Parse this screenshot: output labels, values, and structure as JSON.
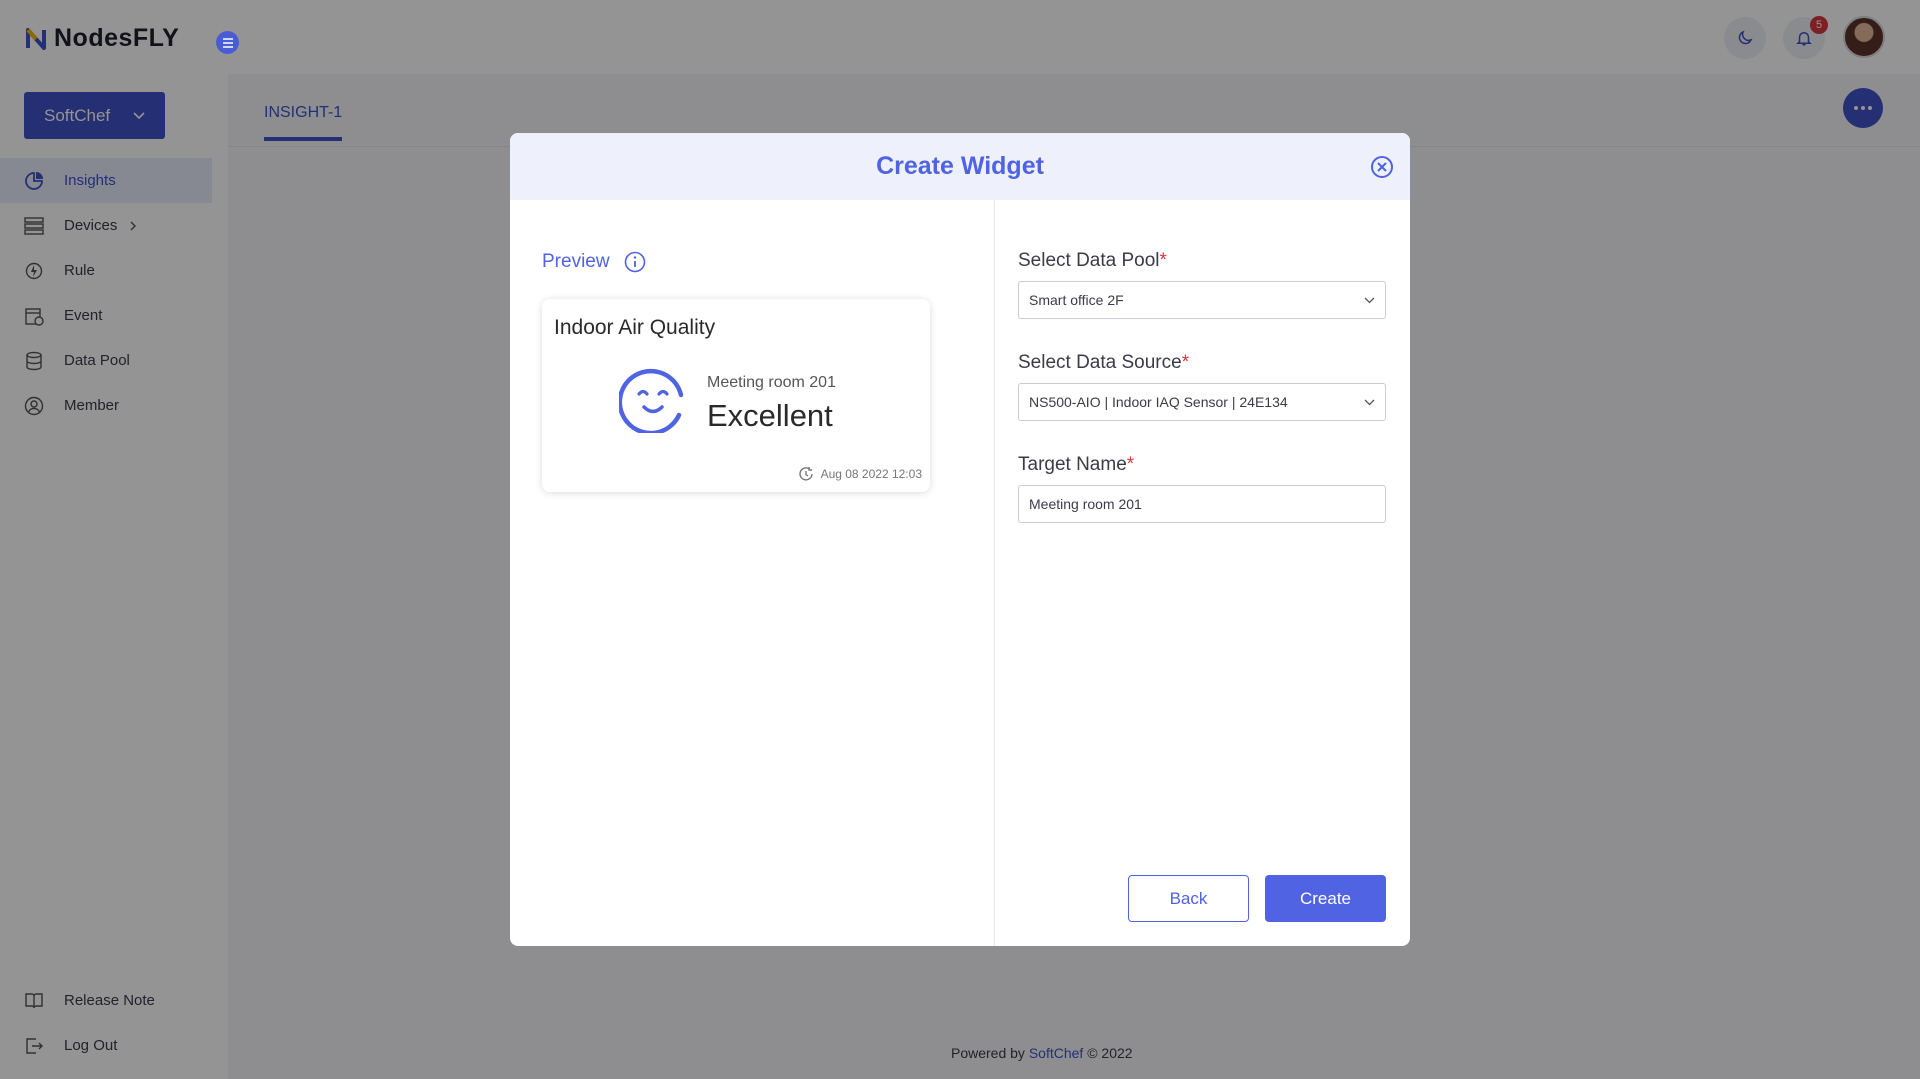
{
  "app": {
    "name": "NodesFLY"
  },
  "header": {
    "notification_count": "5"
  },
  "sidebar": {
    "org": "SoftChef",
    "items": [
      {
        "label": "Insights",
        "icon": "pie-chart-icon",
        "active": true
      },
      {
        "label": "Devices",
        "icon": "devices-grid-icon",
        "has_submenu": true
      },
      {
        "label": "Rule",
        "icon": "rule-icon"
      },
      {
        "label": "Event",
        "icon": "event-icon"
      },
      {
        "label": "Data Pool",
        "icon": "database-icon"
      },
      {
        "label": "Member",
        "icon": "member-icon"
      }
    ],
    "bottom_items": [
      {
        "label": "Release Note",
        "icon": "book-icon"
      },
      {
        "label": "Log Out",
        "icon": "logout-icon"
      }
    ]
  },
  "tabs": [
    {
      "label": "INSIGHT-1",
      "active": true
    }
  ],
  "footer": {
    "prefix": "Powered by",
    "brand": "SoftChef",
    "suffix": "© 2022"
  },
  "modal": {
    "title": "Create Widget",
    "preview_label": "Preview",
    "widget": {
      "title": "Indoor Air Quality",
      "target": "Meeting room 201",
      "value": "Excellent",
      "timestamp": "Aug 08 2022 12:03"
    },
    "fields": {
      "data_pool": {
        "label": "Select Data Pool",
        "required_mark": "*",
        "value": "Smart office 2F"
      },
      "data_source": {
        "label": "Select Data Source",
        "required_mark": "*",
        "value": "NS500-AIO | Indoor IAQ Sensor | 24E134"
      },
      "target_name": {
        "label": "Target Name",
        "required_mark": "*",
        "value": "Meeting room 201"
      }
    },
    "buttons": {
      "back": "Back",
      "create": "Create"
    }
  },
  "colors": {
    "accent": "#4f63e3",
    "primary": "#3f51c9",
    "required": "#e0323c",
    "badge": "#d9363e"
  }
}
